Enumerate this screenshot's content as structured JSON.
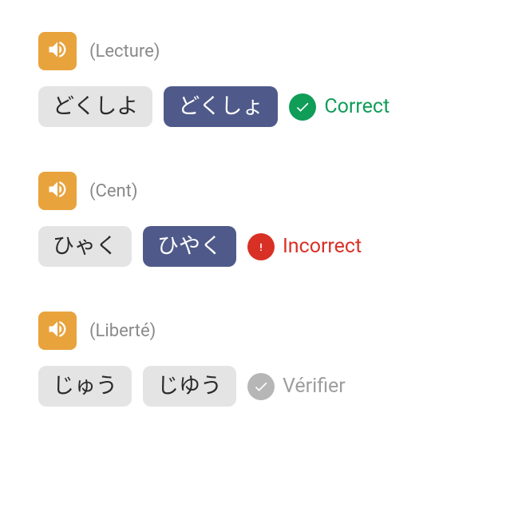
{
  "questions": [
    {
      "prompt": "(Lecture)",
      "choices": [
        {
          "text": "どくしよ",
          "selected": false
        },
        {
          "text": "どくしょ",
          "selected": true
        }
      ],
      "status": {
        "state": "correct",
        "label": "Correct"
      }
    },
    {
      "prompt": "(Cent)",
      "choices": [
        {
          "text": "ひゃく",
          "selected": false
        },
        {
          "text": "ひやく",
          "selected": true
        }
      ],
      "status": {
        "state": "incorrect",
        "label": "Incorrect"
      }
    },
    {
      "prompt": "(Liberté)",
      "choices": [
        {
          "text": "じゅう",
          "selected": false
        },
        {
          "text": "じゆう",
          "selected": false
        }
      ],
      "status": {
        "state": "neutral",
        "label": "Vérifier"
      }
    }
  ]
}
